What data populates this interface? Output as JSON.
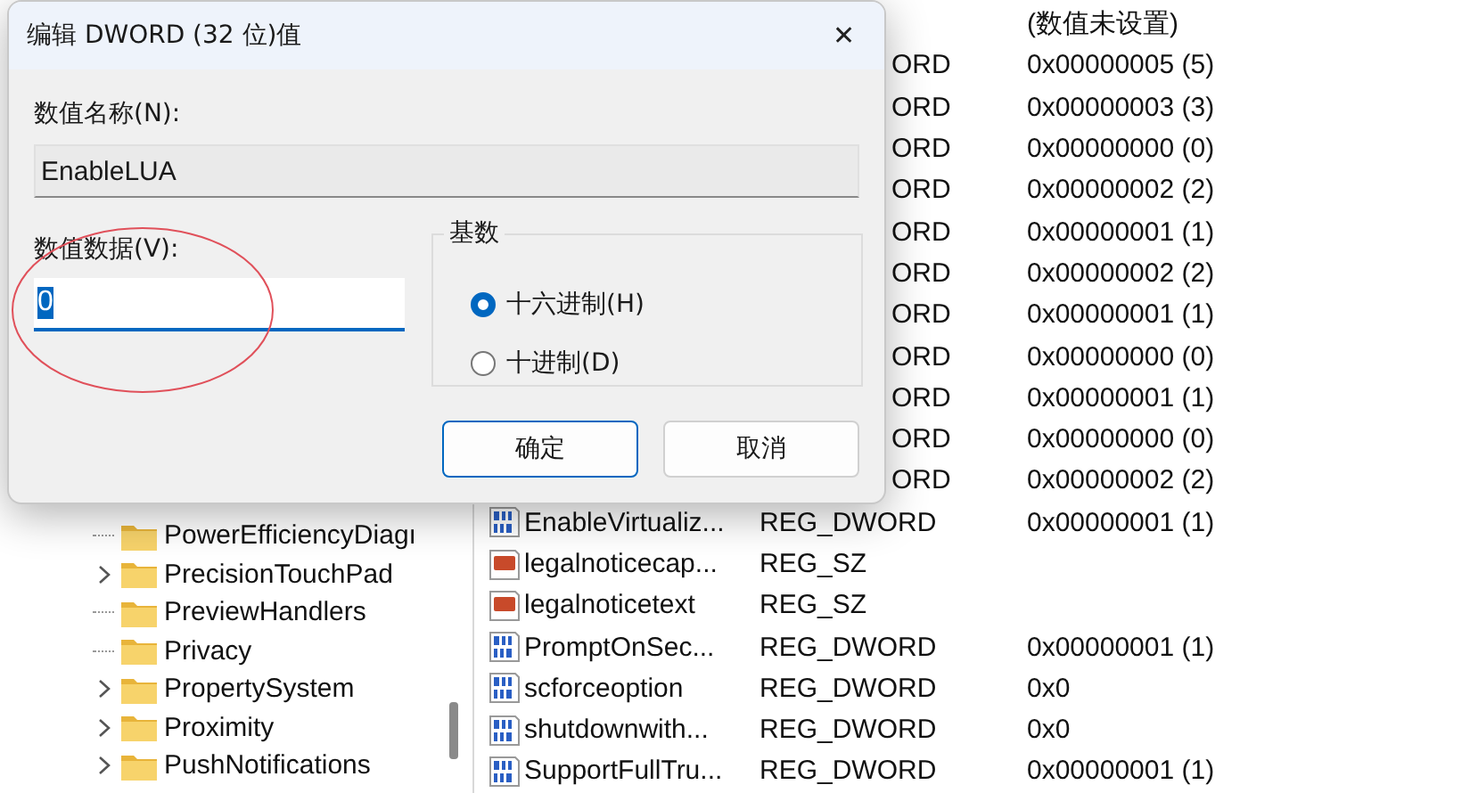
{
  "tree": {
    "items": [
      {
        "label": "PowerEfficiencyDiagı",
        "has_children": false
      },
      {
        "label": "PrecisionTouchPad",
        "has_children": true
      },
      {
        "label": "PreviewHandlers",
        "has_children": false
      },
      {
        "label": "Privacy",
        "has_children": false
      },
      {
        "label": "PropertySystem",
        "has_children": true
      },
      {
        "label": "Proximity",
        "has_children": true
      },
      {
        "label": "PushNotifications",
        "has_children": true
      }
    ]
  },
  "values": {
    "rows": [
      {
        "data": "(数值未设置)"
      },
      {
        "type": "ORD",
        "data": "0x00000005 (5)"
      },
      {
        "type": "ORD",
        "data": "0x00000003 (3)"
      },
      {
        "type": "ORD",
        "data": "0x00000000 (0)"
      },
      {
        "type": "ORD",
        "data": "0x00000002 (2)"
      },
      {
        "type": "ORD",
        "data": "0x00000001 (1)"
      },
      {
        "type": "ORD",
        "data": "0x00000002 (2)"
      },
      {
        "type": "ORD",
        "data": "0x00000001 (1)"
      },
      {
        "type": "ORD",
        "data": "0x00000000 (0)"
      },
      {
        "type": "ORD",
        "data": "0x00000001 (1)"
      },
      {
        "type": "ORD",
        "data": "0x00000000 (0)"
      },
      {
        "type": "ORD",
        "data": "0x00000002 (2)"
      },
      {
        "kind": "dword",
        "name": "EnableVirtualiz...",
        "type": "REG_DWORD",
        "data": "0x00000001 (1)"
      },
      {
        "kind": "string",
        "name": "legalnoticecap...",
        "type": "REG_SZ"
      },
      {
        "kind": "string",
        "name": "legalnoticetext",
        "type": "REG_SZ"
      },
      {
        "kind": "dword",
        "name": "PromptOnSec...",
        "type": "REG_DWORD",
        "data": "0x00000001 (1)"
      },
      {
        "kind": "dword",
        "name": "scforceoption",
        "type": "REG_DWORD",
        "data": "0x0"
      },
      {
        "kind": "dword",
        "name": "shutdownwith...",
        "type": "REG_DWORD",
        "data": "0x0"
      },
      {
        "kind": "dword",
        "name": "SupportFullTru...",
        "type": "REG_DWORD",
        "data": "0x00000001 (1)"
      }
    ]
  },
  "dialog": {
    "title": "编辑 DWORD (32 位)值",
    "close": "✕",
    "name_label": "数值名称(N):",
    "name_value": "EnableLUA",
    "data_label": "数值数据(V):",
    "data_value": "0",
    "base": {
      "title": "基数",
      "options": [
        {
          "label": "十六进制(H)",
          "selected": true
        },
        {
          "label": "十进制(D)",
          "selected": false
        }
      ]
    },
    "buttons": [
      {
        "label": "确定",
        "primary": true
      },
      {
        "label": "取消",
        "primary": false
      }
    ]
  }
}
